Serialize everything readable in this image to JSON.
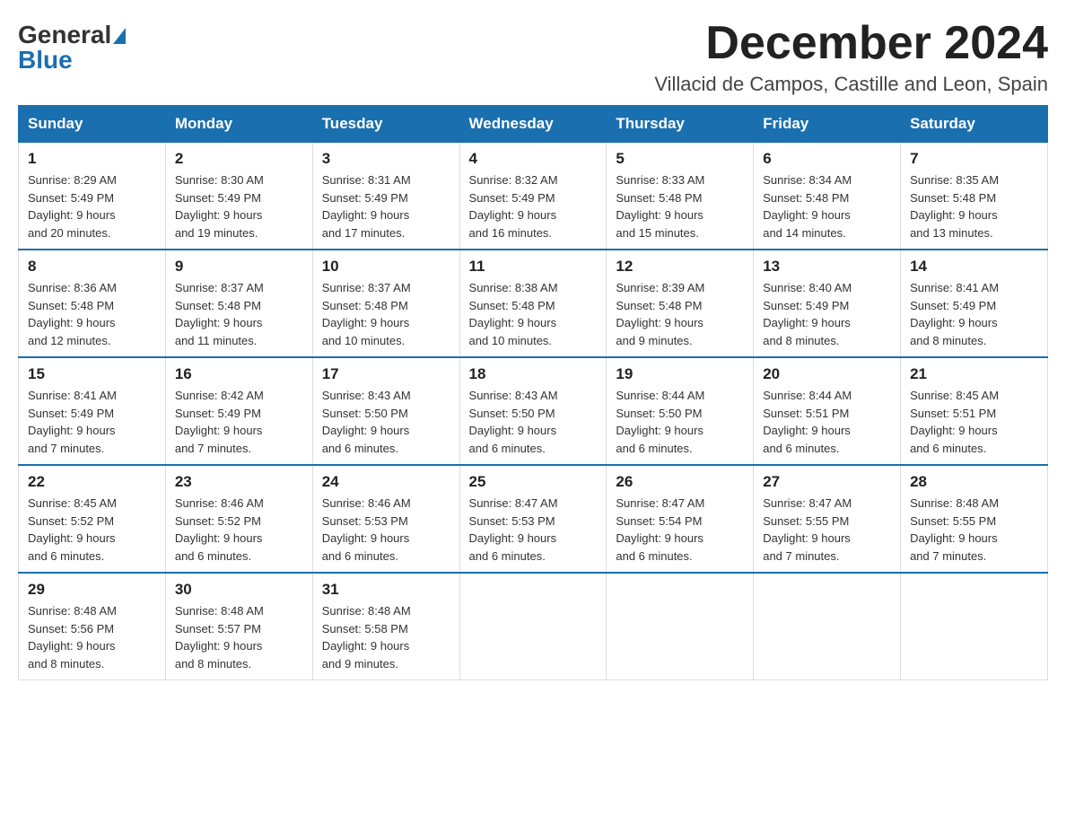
{
  "logo": {
    "general": "General",
    "blue": "Blue",
    "alt": "GeneralBlue logo"
  },
  "title": "December 2024",
  "subtitle": "Villacid de Campos, Castille and Leon, Spain",
  "days_of_week": [
    "Sunday",
    "Monday",
    "Tuesday",
    "Wednesday",
    "Thursday",
    "Friday",
    "Saturday"
  ],
  "weeks": [
    [
      {
        "day": "1",
        "sunrise": "8:29 AM",
        "sunset": "5:49 PM",
        "daylight": "9 hours and 20 minutes."
      },
      {
        "day": "2",
        "sunrise": "8:30 AM",
        "sunset": "5:49 PM",
        "daylight": "9 hours and 19 minutes."
      },
      {
        "day": "3",
        "sunrise": "8:31 AM",
        "sunset": "5:49 PM",
        "daylight": "9 hours and 17 minutes."
      },
      {
        "day": "4",
        "sunrise": "8:32 AM",
        "sunset": "5:49 PM",
        "daylight": "9 hours and 16 minutes."
      },
      {
        "day": "5",
        "sunrise": "8:33 AM",
        "sunset": "5:48 PM",
        "daylight": "9 hours and 15 minutes."
      },
      {
        "day": "6",
        "sunrise": "8:34 AM",
        "sunset": "5:48 PM",
        "daylight": "9 hours and 14 minutes."
      },
      {
        "day": "7",
        "sunrise": "8:35 AM",
        "sunset": "5:48 PM",
        "daylight": "9 hours and 13 minutes."
      }
    ],
    [
      {
        "day": "8",
        "sunrise": "8:36 AM",
        "sunset": "5:48 PM",
        "daylight": "9 hours and 12 minutes."
      },
      {
        "day": "9",
        "sunrise": "8:37 AM",
        "sunset": "5:48 PM",
        "daylight": "9 hours and 11 minutes."
      },
      {
        "day": "10",
        "sunrise": "8:37 AM",
        "sunset": "5:48 PM",
        "daylight": "9 hours and 10 minutes."
      },
      {
        "day": "11",
        "sunrise": "8:38 AM",
        "sunset": "5:48 PM",
        "daylight": "9 hours and 10 minutes."
      },
      {
        "day": "12",
        "sunrise": "8:39 AM",
        "sunset": "5:48 PM",
        "daylight": "9 hours and 9 minutes."
      },
      {
        "day": "13",
        "sunrise": "8:40 AM",
        "sunset": "5:49 PM",
        "daylight": "9 hours and 8 minutes."
      },
      {
        "day": "14",
        "sunrise": "8:41 AM",
        "sunset": "5:49 PM",
        "daylight": "9 hours and 8 minutes."
      }
    ],
    [
      {
        "day": "15",
        "sunrise": "8:41 AM",
        "sunset": "5:49 PM",
        "daylight": "9 hours and 7 minutes."
      },
      {
        "day": "16",
        "sunrise": "8:42 AM",
        "sunset": "5:49 PM",
        "daylight": "9 hours and 7 minutes."
      },
      {
        "day": "17",
        "sunrise": "8:43 AM",
        "sunset": "5:50 PM",
        "daylight": "9 hours and 6 minutes."
      },
      {
        "day": "18",
        "sunrise": "8:43 AM",
        "sunset": "5:50 PM",
        "daylight": "9 hours and 6 minutes."
      },
      {
        "day": "19",
        "sunrise": "8:44 AM",
        "sunset": "5:50 PM",
        "daylight": "9 hours and 6 minutes."
      },
      {
        "day": "20",
        "sunrise": "8:44 AM",
        "sunset": "5:51 PM",
        "daylight": "9 hours and 6 minutes."
      },
      {
        "day": "21",
        "sunrise": "8:45 AM",
        "sunset": "5:51 PM",
        "daylight": "9 hours and 6 minutes."
      }
    ],
    [
      {
        "day": "22",
        "sunrise": "8:45 AM",
        "sunset": "5:52 PM",
        "daylight": "9 hours and 6 minutes."
      },
      {
        "day": "23",
        "sunrise": "8:46 AM",
        "sunset": "5:52 PM",
        "daylight": "9 hours and 6 minutes."
      },
      {
        "day": "24",
        "sunrise": "8:46 AM",
        "sunset": "5:53 PM",
        "daylight": "9 hours and 6 minutes."
      },
      {
        "day": "25",
        "sunrise": "8:47 AM",
        "sunset": "5:53 PM",
        "daylight": "9 hours and 6 minutes."
      },
      {
        "day": "26",
        "sunrise": "8:47 AM",
        "sunset": "5:54 PM",
        "daylight": "9 hours and 6 minutes."
      },
      {
        "day": "27",
        "sunrise": "8:47 AM",
        "sunset": "5:55 PM",
        "daylight": "9 hours and 7 minutes."
      },
      {
        "day": "28",
        "sunrise": "8:48 AM",
        "sunset": "5:55 PM",
        "daylight": "9 hours and 7 minutes."
      }
    ],
    [
      {
        "day": "29",
        "sunrise": "8:48 AM",
        "sunset": "5:56 PM",
        "daylight": "9 hours and 8 minutes."
      },
      {
        "day": "30",
        "sunrise": "8:48 AM",
        "sunset": "5:57 PM",
        "daylight": "9 hours and 8 minutes."
      },
      {
        "day": "31",
        "sunrise": "8:48 AM",
        "sunset": "5:58 PM",
        "daylight": "9 hours and 9 minutes."
      },
      null,
      null,
      null,
      null
    ]
  ],
  "labels": {
    "sunrise": "Sunrise:",
    "sunset": "Sunset:",
    "daylight": "Daylight:"
  }
}
